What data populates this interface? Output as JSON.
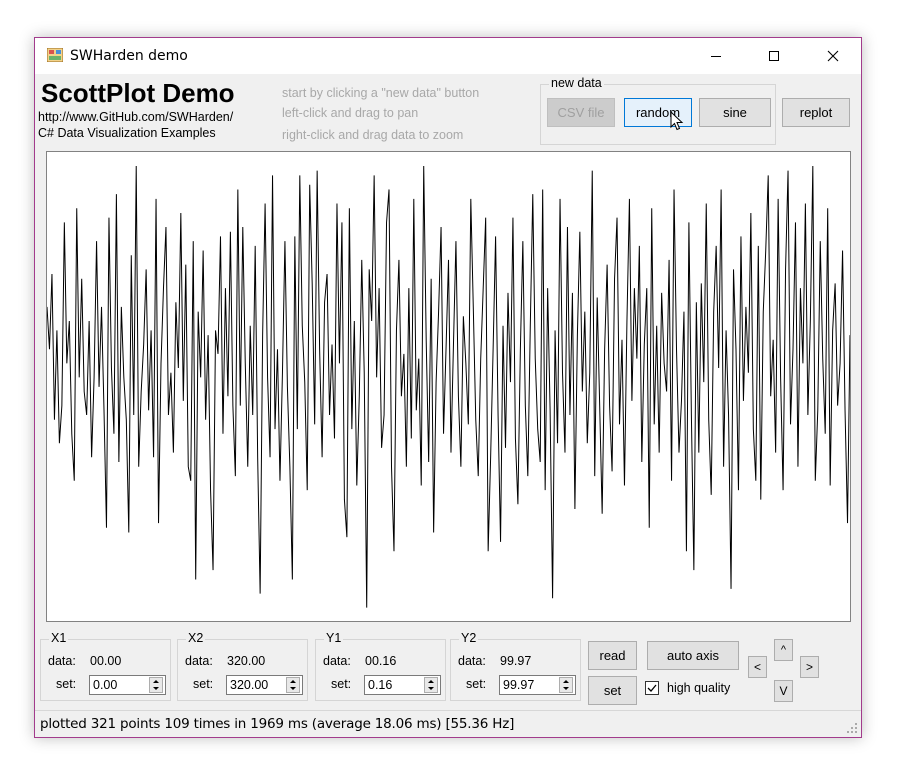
{
  "window": {
    "title": "SWHarden demo",
    "border_color": "#a23b8c"
  },
  "header": {
    "app_title": "ScottPlot Demo",
    "link": "http://www.GitHub.com/SWHarden/",
    "subtitle": "C# Data Visualization Examples",
    "hints": [
      "start by clicking a \"new data\" button",
      "left-click and drag to pan",
      "right-click and drag data to zoom"
    ]
  },
  "new_data": {
    "group_label": "new data",
    "buttons": {
      "csv": "CSV file",
      "random": "random",
      "sine": "sine"
    }
  },
  "replot_label": "replot",
  "chart_data": {
    "type": "line",
    "title": "",
    "xlabel": "",
    "ylabel": "",
    "xlim": [
      0,
      320
    ],
    "ylim": [
      0.16,
      99.97
    ],
    "grid": false,
    "series": [
      {
        "color": "#000000",
        "values": [
          67,
          58,
          74,
          43,
          62,
          38,
          46,
          85,
          55,
          64,
          40,
          30,
          88,
          52,
          73,
          49,
          44,
          64,
          35,
          52,
          81,
          50,
          67,
          45,
          20,
          86,
          54,
          40,
          91,
          34,
          67,
          52,
          43,
          19,
          78,
          44,
          97,
          33,
          49,
          59,
          75,
          45,
          62,
          35,
          90,
          21,
          55,
          71,
          84,
          44,
          53,
          36,
          68,
          54,
          87,
          47,
          76,
          33,
          30,
          81,
          9,
          66,
          52,
          79,
          43,
          61,
          28,
          11,
          62,
          57,
          82,
          40,
          71,
          48,
          83,
          46,
          31,
          92,
          46,
          84,
          55,
          33,
          63,
          44,
          80,
          35,
          6,
          61,
          89,
          52,
          35,
          95,
          41,
          58,
          30,
          53,
          81,
          50,
          33,
          9,
          82,
          41,
          95,
          63,
          51,
          28,
          93,
          72,
          42,
          96,
          58,
          35,
          68,
          74,
          44,
          59,
          39,
          89,
          55,
          85,
          26,
          18,
          88,
          41,
          64,
          29,
          48,
          77,
          53,
          3,
          75,
          64,
          95,
          52,
          71,
          37,
          44,
          85,
          92,
          33,
          15,
          62,
          77,
          48,
          57,
          33,
          71,
          39,
          90,
          45,
          56,
          29,
          97,
          60,
          34,
          73,
          19,
          51,
          66,
          84,
          40,
          58,
          77,
          36,
          59,
          81,
          48,
          33,
          65,
          55,
          42,
          90,
          67,
          43,
          31,
          56,
          71,
          86,
          15,
          35,
          58,
          82,
          44,
          17,
          63,
          37,
          70,
          51,
          86,
          39,
          25,
          58,
          81,
          46,
          31,
          63,
          91,
          56,
          41,
          34,
          92,
          28,
          71,
          45,
          5,
          62,
          38,
          90,
          53,
          36,
          84,
          44,
          70,
          24,
          61,
          83,
          49,
          66,
          38,
          53,
          96,
          31,
          69,
          46,
          23,
          58,
          76,
          46,
          32,
          73,
          86,
          42,
          60,
          29,
          64,
          90,
          47,
          71,
          56,
          80,
          34,
          59,
          71,
          20,
          88,
          42,
          63,
          36,
          70,
          55,
          49,
          77,
          30,
          92,
          58,
          36,
          47,
          66,
          15,
          85,
          44,
          11,
          68,
          36,
          72,
          51,
          89,
          43,
          27,
          66,
          80,
          54,
          92,
          33,
          62,
          44,
          7,
          75,
          58,
          28,
          82,
          47,
          67,
          53,
          87,
          41,
          30,
          80,
          26,
          66,
          79,
          95,
          48,
          60,
          36,
          90,
          52,
          28,
          75,
          96,
          42,
          58,
          85,
          33,
          71,
          55,
          89,
          44,
          64,
          97,
          30,
          45,
          81,
          56,
          40,
          88,
          29,
          62,
          72,
          46,
          55,
          79,
          45,
          21,
          61
        ]
      }
    ]
  },
  "controls": {
    "x1": {
      "label": "X1",
      "data_label": "data:",
      "data_value": "00.00",
      "set_label": "set:",
      "set_value": "0.00"
    },
    "x2": {
      "label": "X2",
      "data_label": "data:",
      "data_value": "320.00",
      "set_label": "set:",
      "set_value": "320.00"
    },
    "y1": {
      "label": "Y1",
      "data_label": "data:",
      "data_value": "00.16",
      "set_label": "set:",
      "set_value": "0.16"
    },
    "y2": {
      "label": "Y2",
      "data_label": "data:",
      "data_value": "99.97",
      "set_label": "set:",
      "set_value": "99.97"
    },
    "read_label": "read",
    "set_label": "set",
    "auto_axis_label": "auto axis",
    "high_quality_label": "high quality",
    "high_quality_checked": true,
    "nav": {
      "up": "^",
      "down": "V",
      "left": "<",
      "right": ">"
    }
  },
  "status": {
    "text": "plotted 321 points 109 times in 1969 ms (average 18.06 ms) [55.36 Hz]"
  }
}
